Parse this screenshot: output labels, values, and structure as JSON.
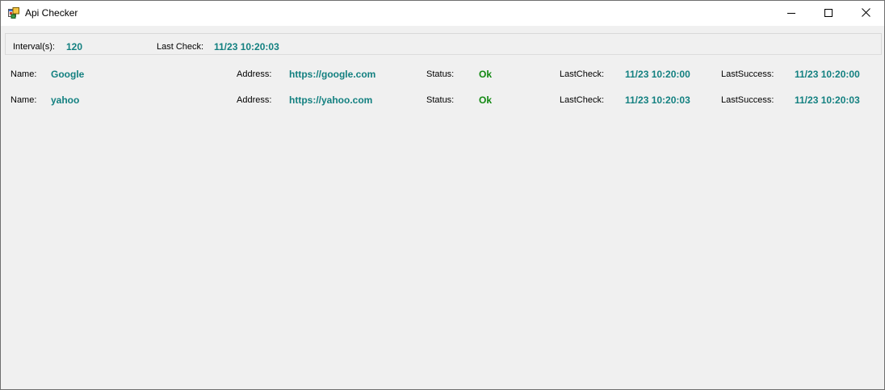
{
  "window": {
    "title": "Api Checker",
    "icon": "app-window-icon",
    "controls": [
      "minimize-icon",
      "maximize-icon",
      "close-icon"
    ]
  },
  "header": {
    "interval_label": "Interval(s):",
    "interval_value": "120",
    "last_check_label": "Last Check:",
    "last_check_value": "11/23 10:20:03"
  },
  "labels": {
    "name": "Name:",
    "address": "Address:",
    "status": "Status:",
    "last_check": "LastCheck:",
    "last_success": "LastSuccess:"
  },
  "apis": [
    {
      "name": "Google",
      "address": "https://google.com",
      "status": "Ok",
      "last_check": "11/23 10:20:00",
      "last_success": "11/23 10:20:00"
    },
    {
      "name": "yahoo",
      "address": "https://yahoo.com",
      "status": "Ok",
      "last_check": "11/23 10:20:03",
      "last_success": "11/23 10:20:03"
    }
  ],
  "colors": {
    "value_teal": "#138080",
    "status_ok_green": "#118811",
    "window_bg": "#f0f0f0"
  }
}
